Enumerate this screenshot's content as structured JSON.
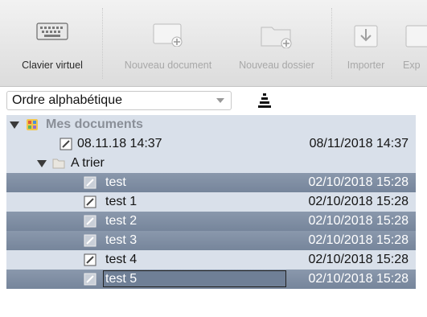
{
  "toolbar": {
    "buttons": [
      {
        "label": "Clavier virtuel",
        "icon": "keyboard-icon",
        "active": true
      },
      {
        "label": "Nouveau document",
        "icon": "new-document-icon",
        "active": false
      },
      {
        "label": "Nouveau dossier",
        "icon": "new-folder-icon",
        "active": false
      },
      {
        "label": "Importer",
        "icon": "import-icon",
        "active": false
      },
      {
        "label": "Exp",
        "icon": "export-icon",
        "active": false
      }
    ]
  },
  "sort": {
    "selected": "Ordre alphabétique",
    "icon": "sort-order-icon"
  },
  "tree": {
    "root": {
      "label": "Mes documents",
      "icon": "documents-app-icon"
    },
    "items": [
      {
        "label": "08.11.18 14:37",
        "date": "08/11/2018 14:37",
        "icon": "note-icon"
      },
      {
        "label": "A trier",
        "icon": "folder-icon"
      },
      {
        "label": "test",
        "date": "02/10/2018 15:28",
        "icon": "note-icon"
      },
      {
        "label": "test 1",
        "date": "02/10/2018 15:28",
        "icon": "note-icon"
      },
      {
        "label": "test 2",
        "date": "02/10/2018 15:28",
        "icon": "note-icon"
      },
      {
        "label": "test 3",
        "date": "02/10/2018 15:28",
        "icon": "note-icon"
      },
      {
        "label": "test 4",
        "date": "02/10/2018 15:28",
        "icon": "note-icon"
      },
      {
        "label": "test 5",
        "date": "02/10/2018 15:28",
        "icon": "note-icon"
      }
    ]
  },
  "colors": {
    "selection": "#7b8aa0",
    "row_background": "#d9e0ea",
    "toolbar_label_disabled": "#a8a8a8"
  }
}
